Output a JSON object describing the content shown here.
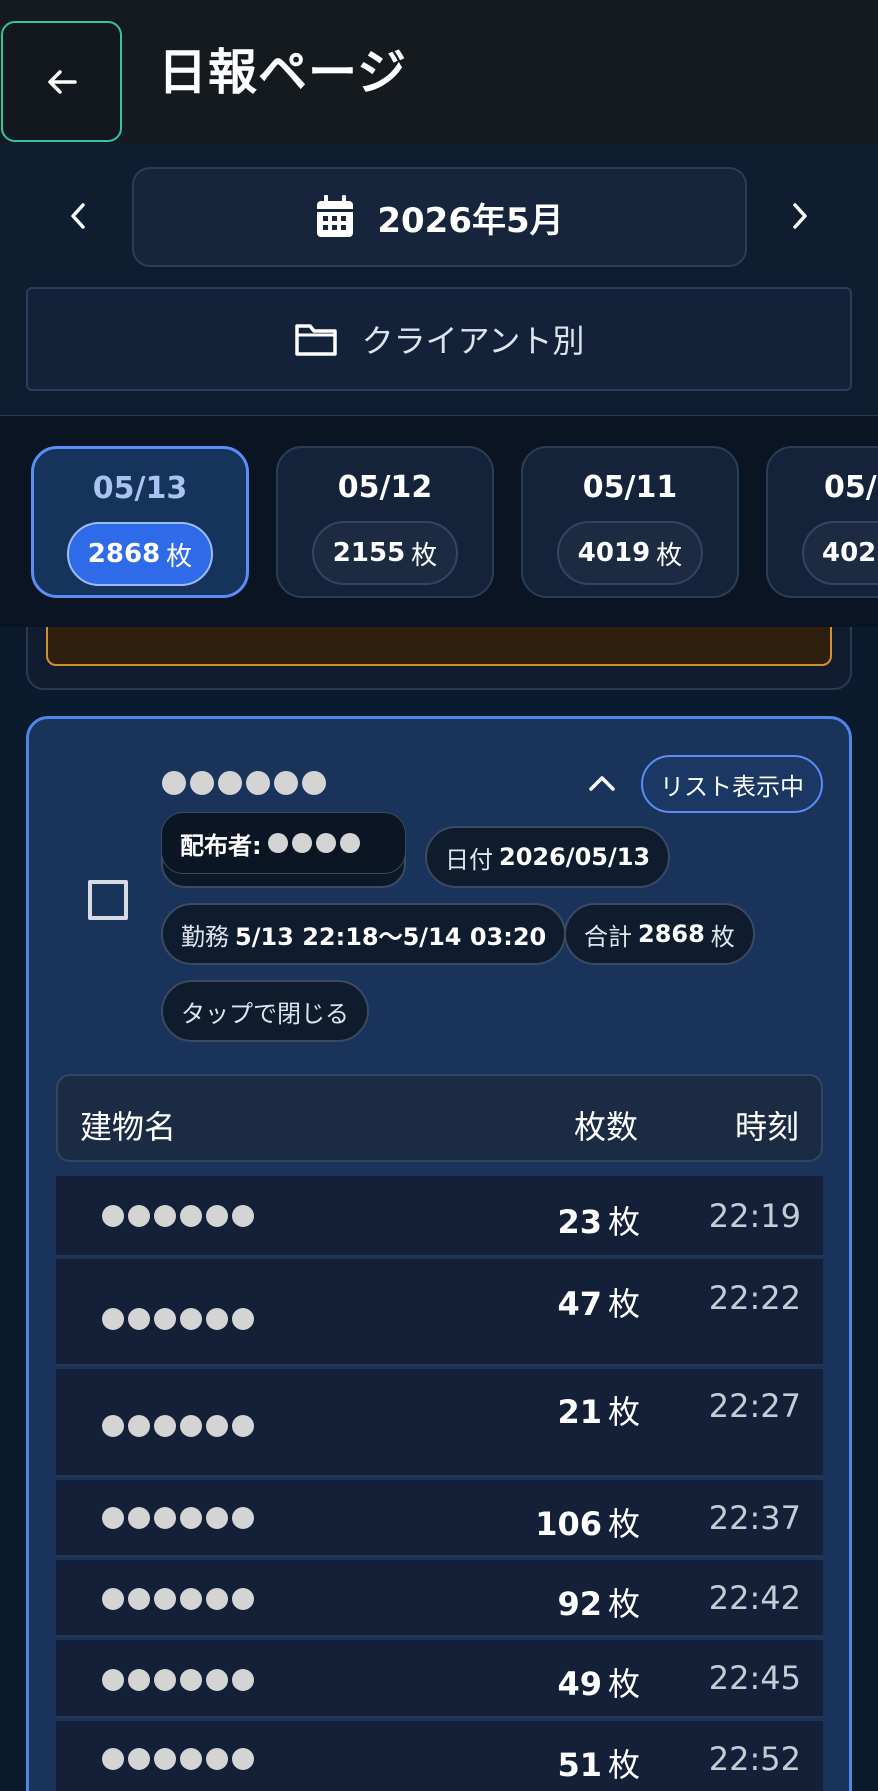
{
  "header": {
    "title": "日報ページ",
    "back_icon": "arrow-left-icon"
  },
  "month_nav": {
    "label": "2026年5月",
    "prev_icon": "chevron-left-icon",
    "next_icon": "chevron-right-icon",
    "calendar_icon": "calendar-icon"
  },
  "client_filter": {
    "label": "クライアント別",
    "icon": "folder-icon"
  },
  "date_cards": [
    {
      "date": "05/13",
      "count": "2868",
      "unit": "枚",
      "active": true
    },
    {
      "date": "05/12",
      "count": "2155",
      "unit": "枚",
      "active": false
    },
    {
      "date": "05/11",
      "count": "4019",
      "unit": "枚",
      "active": false
    },
    {
      "date": "05/",
      "count": "402",
      "unit": "",
      "active": false
    }
  ],
  "report": {
    "list_mode_label": "リスト表示中",
    "distributor_label": "配布者:",
    "date_chip_label": "日付",
    "date_chip_value": "2026/05/13",
    "work_chip_label": "勤務",
    "work_chip_value": "5/13 22:18〜5/14 03:20",
    "total_chip_label": "合計",
    "total_chip_value": "2868",
    "total_chip_unit": "枚",
    "close_chip_label": "タップで閉じる",
    "colors": {
      "accent": "#4f86ea",
      "card_bg": "#19335a",
      "active_pill": "#2f6ae8",
      "back_border": "#2fc4a6"
    }
  },
  "table": {
    "headers": {
      "name": "建物名",
      "count": "枚数",
      "time": "時刻"
    },
    "unit": "枚",
    "rows": [
      {
        "count": "23",
        "time": "22:19"
      },
      {
        "count": "47",
        "time": "22:22"
      },
      {
        "count": "21",
        "time": "22:27"
      },
      {
        "count": "106",
        "time": "22:37"
      },
      {
        "count": "92",
        "time": "22:42"
      },
      {
        "count": "49",
        "time": "22:45"
      },
      {
        "count": "51",
        "time": "22:52"
      }
    ]
  }
}
